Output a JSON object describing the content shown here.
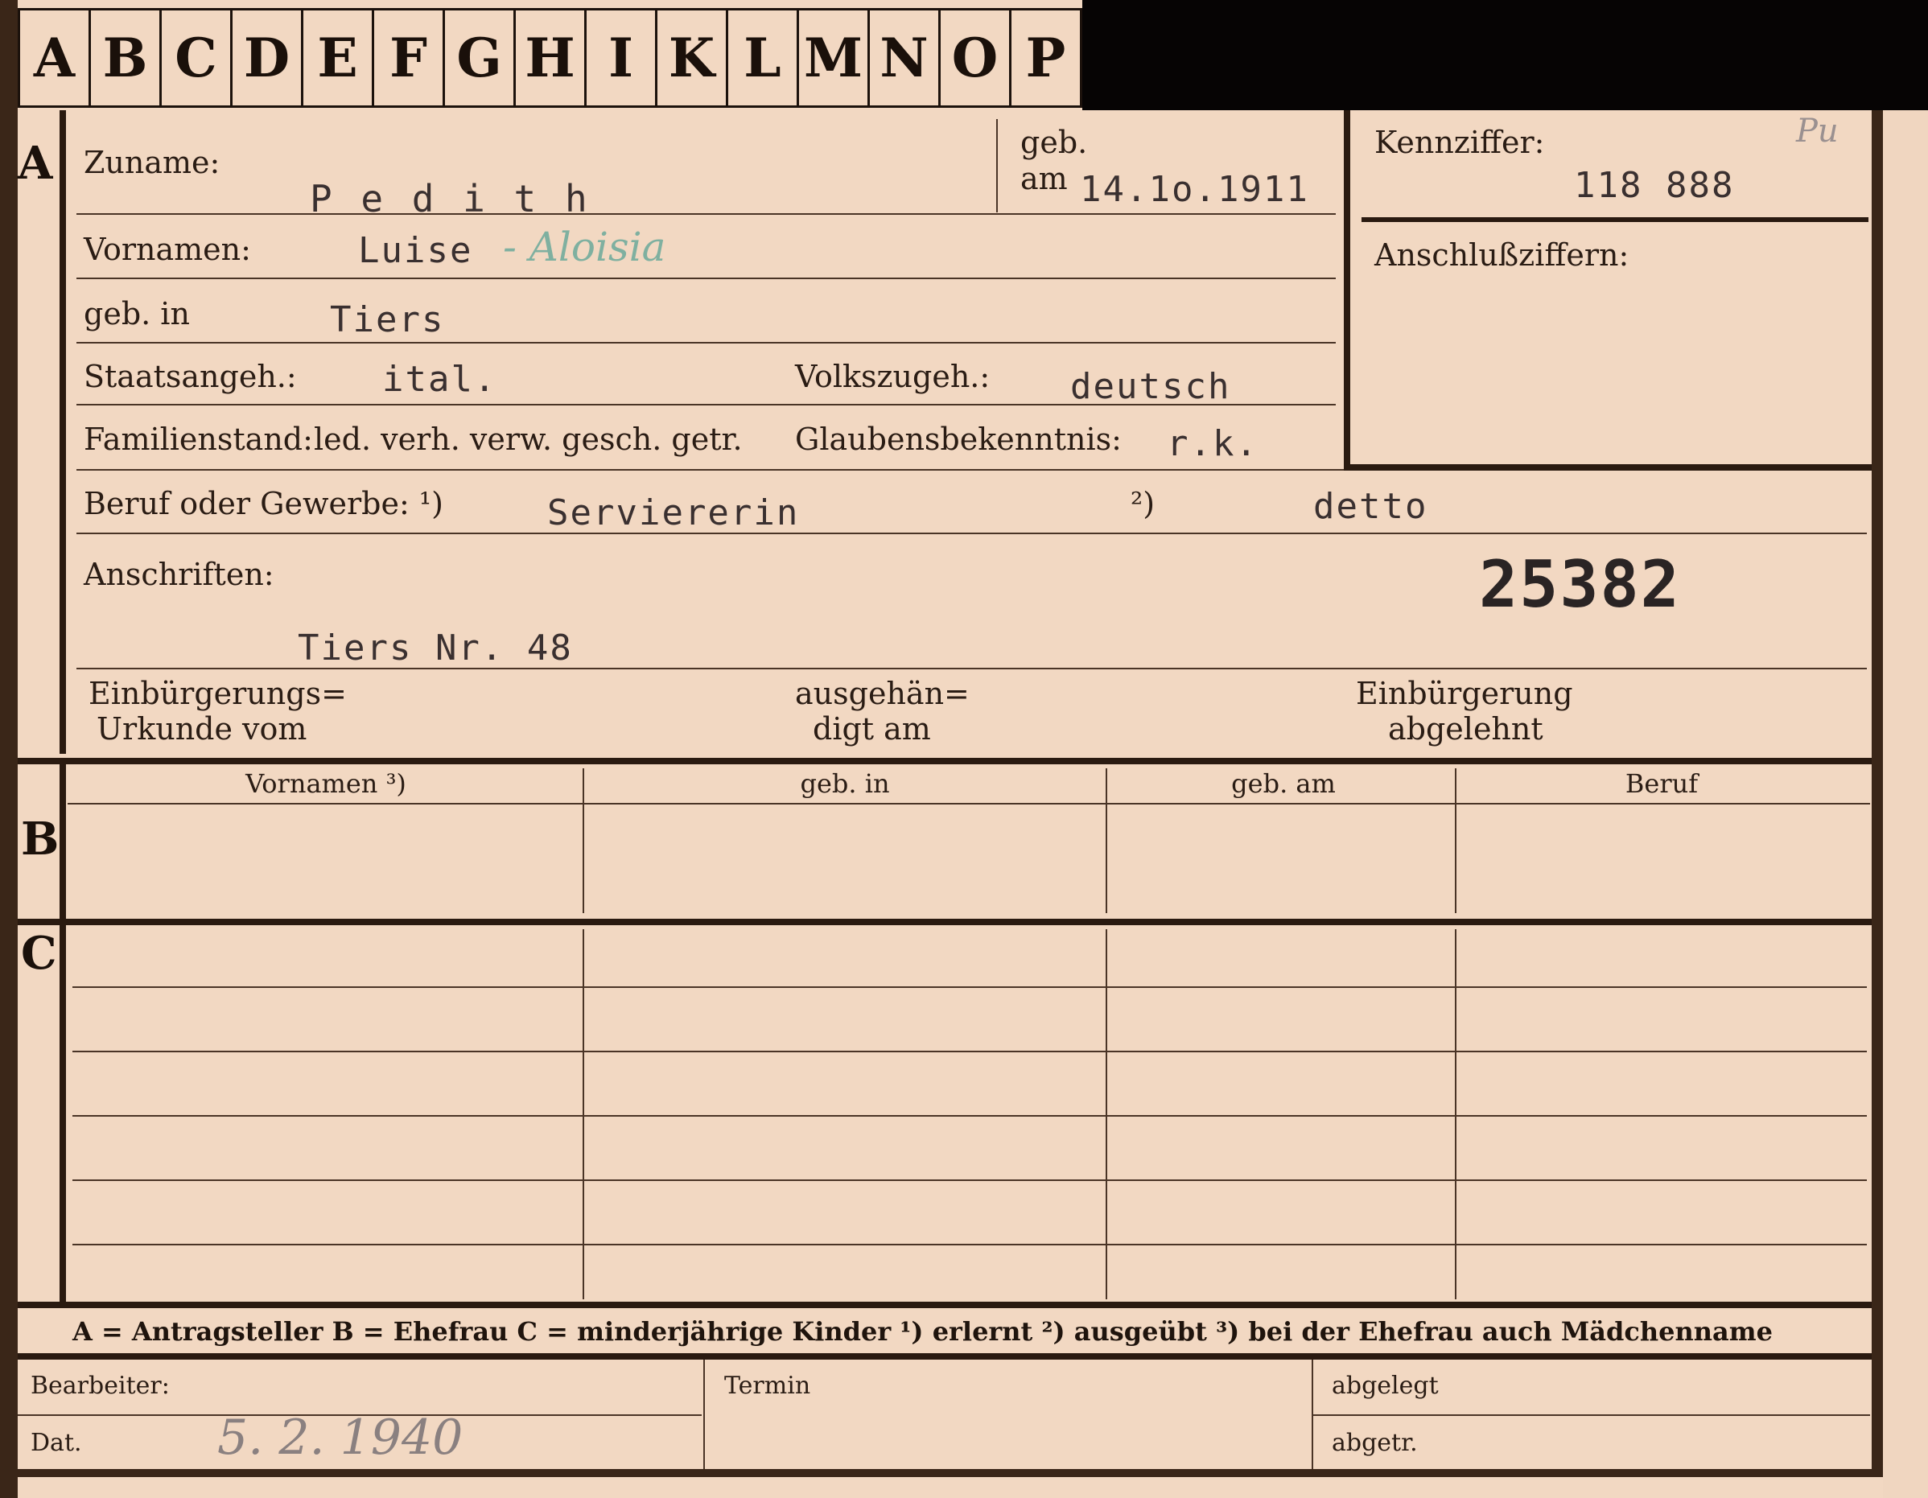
{
  "tabs": [
    "A",
    "B",
    "C",
    "D",
    "E",
    "F",
    "G",
    "H",
    "I",
    "K",
    "L",
    "M",
    "N",
    "O",
    "P"
  ],
  "sections": {
    "a": "A",
    "b": "B",
    "c": "C"
  },
  "labels": {
    "zuname": "Zuname:",
    "geb_am_1": "geb.",
    "geb_am_2": "am",
    "kennziffer": "Kennziffer:",
    "anschlussziffern": "Anschlußziffern:",
    "vornamen": "Vornamen:",
    "geb_in": "geb. in",
    "staatsangeh": "Staatsangeh.:",
    "volkszugeh": "Volkszugeh.:",
    "familienstand": "Familienstand:",
    "familienstand_options": "led. verh. verw. gesch. getr.",
    "glaubensbekenntnis": "Glaubensbekenntnis:",
    "beruf": "Beruf oder Gewerbe: ¹)",
    "beruf_2": "²)",
    "anschriften": "Anschriften:",
    "einbuergerungs_1": "Einbürgerungs=",
    "einbuergerungs_2": "Urkunde vom",
    "ausgehaen_1": "ausgehän=",
    "ausgehaen_2": "digt am",
    "einbuergerung_1": "Einbürgerung",
    "einbuergerung_2": "abgelehnt",
    "bearbeiter": "Bearbeiter:",
    "dat": "Dat.",
    "termin": "Termin",
    "abgelegt": "abgelegt",
    "abgetr": "abgetr."
  },
  "columns": [
    "Vornamen ³)",
    "geb. in",
    "geb. am",
    "Beruf"
  ],
  "legend": "A = Antragsteller   B = Ehefrau   C = minderjährige Kinder   ¹) erlernt   ²) ausgeübt   ³) bei der Ehefrau auch Mädchenname",
  "values": {
    "zuname": "P e d i t h",
    "geb_am": "14.1o.1911",
    "kennziffer_note": "Pu",
    "kennziffer": "118 888",
    "vornamen": "Luise",
    "vornamen_hand": "- Aloisia",
    "geb_in": "Tiers",
    "staatsangeh": "ital.",
    "volkszugeh": "deutsch",
    "glaubensbekenntnis": "r.k.",
    "beruf_1": "Serviererin",
    "beruf_2": "detto",
    "stamp_number": "25382",
    "anschrift": "Tiers Nr. 48",
    "dat": "5. 2. 1940"
  },
  "colors": {
    "card": "#f2d8c2",
    "ink": "#2a1c14",
    "typewriter": "#3a3030",
    "green_ink": "#7fb0a0",
    "pencil": "#8a8080"
  }
}
